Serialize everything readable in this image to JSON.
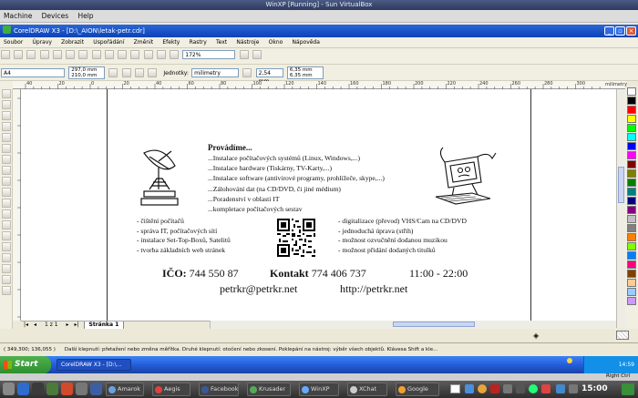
{
  "host": {
    "window_title": "WinXP [Running] - Sun VirtualBox",
    "menu": [
      "Machine",
      "Devices",
      "Help"
    ]
  },
  "corel": {
    "window_title": "CorelDRAW X3 - [D:\\_AION\\letak-petr.cdr]",
    "menu": [
      "Soubor",
      "Úpravy",
      "Zobrazit",
      "Uspořádání",
      "Změnit",
      "Efekty",
      "Rastry",
      "Text",
      "Nástroje",
      "Okno",
      "Nápověda"
    ],
    "zoom": "172%",
    "paper_size": "A4",
    "width": "297,0 mm",
    "height": "210,0 mm",
    "units_label": "Jednotky:",
    "units": "milimetry",
    "nudge": "2,54 mm",
    "dup_x": "6,35 mm",
    "dup_y": "6,35 mm",
    "ruler_unit": "milimetry",
    "ruler_ticks": [
      "40",
      "20",
      "0",
      "20",
      "40",
      "60",
      "80",
      "100",
      "120",
      "140",
      "160",
      "180",
      "200",
      "220",
      "240",
      "260",
      "280",
      "300"
    ],
    "page_counter": "1 z 1",
    "page_tab": "Stránka 1",
    "status_coords": "( 349,300; 136,055 )",
    "status_hint": "Další klepnutí: přetažení nebo změna měřítka. Druhé klepnutí: otočení nebo zkosení. Poklepání na nástroj: výběr všech objektů. Klávesa Shift a kle..."
  },
  "leaflet": {
    "heading": "Provádíme...",
    "services": [
      "...Instalace počítačových systémů (Linux, Windows,...)",
      "...Instalace hardware (Tiskárny, TV-Karty,...)",
      "...Instalace software (antivirové programy, prohlížeče, skype,...)",
      "...Zálohování dat (na CD/DVD, či jiné médium)",
      "...Poradenství v oblasti IT",
      "...kompletace počítačových sestav"
    ],
    "left_list": [
      "- čištění počítačů",
      "- správa IT, počítačových sítí",
      "- instalace Set-Top-Boxů, Satelitů",
      "- tvorba základních web stránek"
    ],
    "right_list": [
      "- digitalizace (převod) VHS/Cam na CD/DVD",
      "- jednoduchá úprava (střih)",
      "- možnost ozvučnění dodanou muzikou",
      "- možnost přidání dodaných titulků"
    ],
    "ico_label": "IČO:",
    "ico_value": "744 550 87",
    "contact_label": "Kontakt",
    "contact_value": "774 406 737",
    "hours": "11:00 - 22:00",
    "email": "petrkr@petrkr.net",
    "web": "http://petrkr.net"
  },
  "guest_taskbar": {
    "start": "Start",
    "task": "CorelDRAW X3 - [D:\\...",
    "clock": "14:59"
  },
  "host_taskbar": {
    "tasks": [
      "Amarok",
      "Aegis",
      "Facebook",
      "Krusader",
      "WinXP",
      "XChat",
      "Google"
    ],
    "clock": "15:00",
    "host_key": "Right Ctrl"
  },
  "colors": {
    "xp_blue": "#245edb",
    "corel_title": "#0a43b8",
    "palette": [
      "#ffffff",
      "#000000",
      "#ff0000",
      "#ffff00",
      "#00ff00",
      "#00ffff",
      "#0000ff",
      "#ff00ff",
      "#800000",
      "#808000",
      "#008000",
      "#008080",
      "#000080",
      "#800080",
      "#c0c0c0",
      "#808080",
      "#ff8000",
      "#80ff00",
      "#0080ff",
      "#ff0080",
      "#804000",
      "#ffcc99",
      "#99ccff",
      "#cc99ff"
    ]
  }
}
